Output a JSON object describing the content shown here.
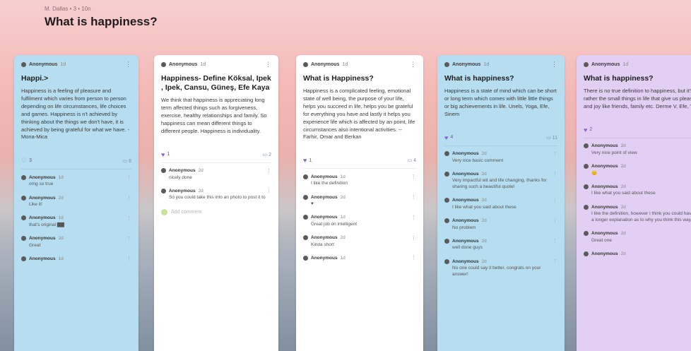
{
  "header": {
    "breadcrumb": "M. Dallas • 3 • 10n",
    "title": "What is happiness?"
  },
  "columns": [
    {
      "author": "Anonymous",
      "time": "1d",
      "title": "Happi.>",
      "body": "Happiness is a feeling of pleasure and fulfilment which varies from person to person depending on life circumstances, life choices and games. Happiness is n't achieved by thinking about the things we don't have, it is achieved by being grateful for what we have. -Mona-Mica",
      "likes": "3",
      "comments_count": "8",
      "liked": false,
      "comments": [
        {
          "author": "Anonymous",
          "time": "1d",
          "text": "omg so true"
        },
        {
          "author": "Anonymous",
          "time": "2d",
          "text": "Like it!"
        },
        {
          "author": "Anonymous",
          "time": "1d",
          "text": "that's original ▇▇"
        },
        {
          "author": "Anonymous",
          "time": "2d",
          "text": "Great"
        },
        {
          "author": "Anonymous",
          "time": "1d",
          "text": ""
        }
      ]
    },
    {
      "author": "Anonymous",
      "time": "1d",
      "title": "Happiness- Define Köksal, Ipek , Ipek, Cansu, Güneş, Efe Kaya",
      "body": "We think that happiness is appreciating long term affected things such as forgiveness, exercise, healthy relationships and family. So happiness can mean different things to different people. Happiness is individuality.",
      "likes": "1",
      "comments_count": "2",
      "liked": true,
      "comments": [
        {
          "author": "Anonymous",
          "time": "2d",
          "text": "nicely done"
        },
        {
          "author": "Anonymous",
          "time": "2d",
          "text": "So you could take this into an photo to post it to"
        }
      ],
      "add_comment": "Add comment"
    },
    {
      "author": "Anonymous",
      "time": "1d",
      "title": "What is Happiness?",
      "body": "Happiness is a complicated feeling, emotional state of well being, the purpose of your life, helps you succeed in life, helps you be grateful for everything you have and lastly it helps you experience life which is affected by an point, life circumstances also intentional activities. --Farhir, Omar and Berkan",
      "likes": "1",
      "comments_count": "4",
      "liked": true,
      "comments": [
        {
          "author": "Anonymous",
          "time": "1d",
          "text": "I like the definition"
        },
        {
          "author": "Anonymous",
          "time": "2d",
          "text": "♥"
        },
        {
          "author": "Anonymous",
          "time": "1d",
          "text": "Great job on intelligent"
        },
        {
          "author": "Anonymous",
          "time": "2d",
          "text": "Kinda short"
        },
        {
          "author": "Anonymous",
          "time": "1d",
          "text": ""
        }
      ]
    },
    {
      "author": "Anonymous",
      "time": "1d",
      "title": "What is happiness?",
      "body": "Happiness is a state of mind which can be short or long term which comes with little little things or big achievements in life. Unels, Yoga, Efe, Sinem",
      "likes": "4",
      "comments_count": "11",
      "liked": true,
      "comments": [
        {
          "author": "Anonymous",
          "time": "2d",
          "text": "Very nice basic comment"
        },
        {
          "author": "Anonymous",
          "time": "2d",
          "text": "Very impactful wit and life changing, thanks for sharing such a beautiful quote!"
        },
        {
          "author": "Anonymous",
          "time": "2d",
          "text": "I like what you said about these"
        },
        {
          "author": "Anonymous",
          "time": "2d",
          "text": "No problem"
        },
        {
          "author": "Anonymous",
          "time": "2d",
          "text": "well done guys"
        },
        {
          "author": "Anonymous",
          "time": "2d",
          "text": "No one could say it better, congrats on your answer!"
        }
      ]
    },
    {
      "author": "Anonymous",
      "time": "1d",
      "title": "What is happiness?",
      "body": "There is no true definition to happiness, but it's rather the small things in life that give us pleasure and joy like friends, family etc. Derme V, Efe, Yiğit",
      "likes": "2",
      "comments_count": "",
      "liked": true,
      "comments": [
        {
          "author": "Anonymous",
          "time": "2d",
          "text": "Very nice point of view"
        },
        {
          "author": "Anonymous",
          "time": "2d",
          "text": "😊"
        },
        {
          "author": "Anonymous",
          "time": "2d",
          "text": "I like what you said about these"
        },
        {
          "author": "Anonymous",
          "time": "2d",
          "text": "I like the definition, however I think you could have put a longer explanation as to why you think this way."
        },
        {
          "author": "Anonymous",
          "time": "2d",
          "text": "Great one"
        },
        {
          "author": "Anonymous",
          "time": "2d",
          "text": ""
        }
      ]
    }
  ],
  "icons": {
    "like": "heart-icon",
    "comment": "comment-icon",
    "more": "more-icon",
    "avatar": "user-avatar-icon"
  },
  "colors": {
    "blue_card": "#b6def0",
    "white_card": "#ffffff",
    "purple_card": "#e2cff4",
    "like": "#8a63d2"
  }
}
